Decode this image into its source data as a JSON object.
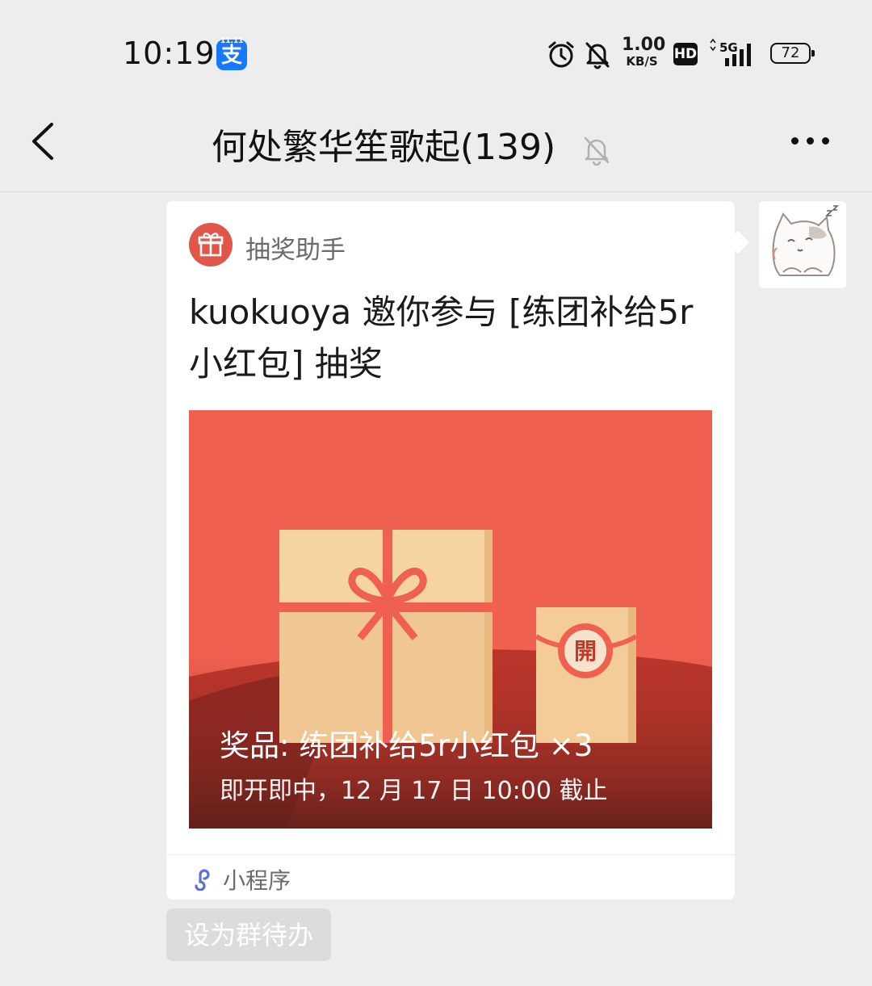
{
  "status_bar": {
    "time": "10:19",
    "app_icon_glyph": "支",
    "app_icon_tag": "11.11",
    "net_speed_value": "1.00",
    "net_speed_unit": "KB/S",
    "hd_label": "HD",
    "network_label": "5G",
    "battery_level": "72",
    "icons": [
      "alarm-icon",
      "mute-bell-icon",
      "signal-icon",
      "battery-icon"
    ]
  },
  "header": {
    "title": "何处繁华笙歌起(139)",
    "back_icon": "chevron-left-icon",
    "mute_icon": "muted-bell-icon",
    "more_icon": "more-dots-icon"
  },
  "message": {
    "source_name": "抽奖助手",
    "source_icon": "gift-icon",
    "title": "kuokuoya 邀你参与 [练团补给5r小红包] 抽奖",
    "prize_text": "奖品: 练团补给5r小红包  ×3",
    "deadline_text": "即开即中，12 月 17 日 10:00 截止",
    "open_seal_glyph": "開",
    "footer_label": "小程序",
    "footer_icon": "mini-program-icon"
  },
  "actions": {
    "todo_label": "设为群待办"
  },
  "colors": {
    "background": "#ededed",
    "card_bg": "#ffffff",
    "cover_red": "#ef6050",
    "gift_badge": "#e0574a",
    "mini_program_blue": "#5b6fd6",
    "todo_button_bg": "#dcdcdc"
  }
}
